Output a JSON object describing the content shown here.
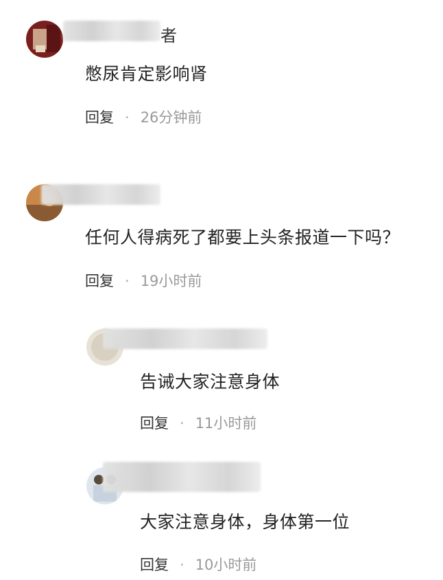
{
  "comments": [
    {
      "name_visible": "者",
      "text": "憋尿肯定影响肾",
      "reply_label": "回复",
      "dot": "·",
      "time": "26分钟前"
    },
    {
      "name_visible": "",
      "text": "任何人得病死了都要上头条报道一下吗？",
      "reply_label": "回复",
      "dot": "·",
      "time": "19小时前"
    },
    {
      "name_visible": "",
      "text": "告诫大家注意身体",
      "reply_label": "回复",
      "dot": "·",
      "time": "11小时前"
    },
    {
      "name_visible": "",
      "text": "大家注意身体，身体第一位",
      "reply_label": "回复",
      "dot": "·",
      "time": "10小时前"
    }
  ]
}
